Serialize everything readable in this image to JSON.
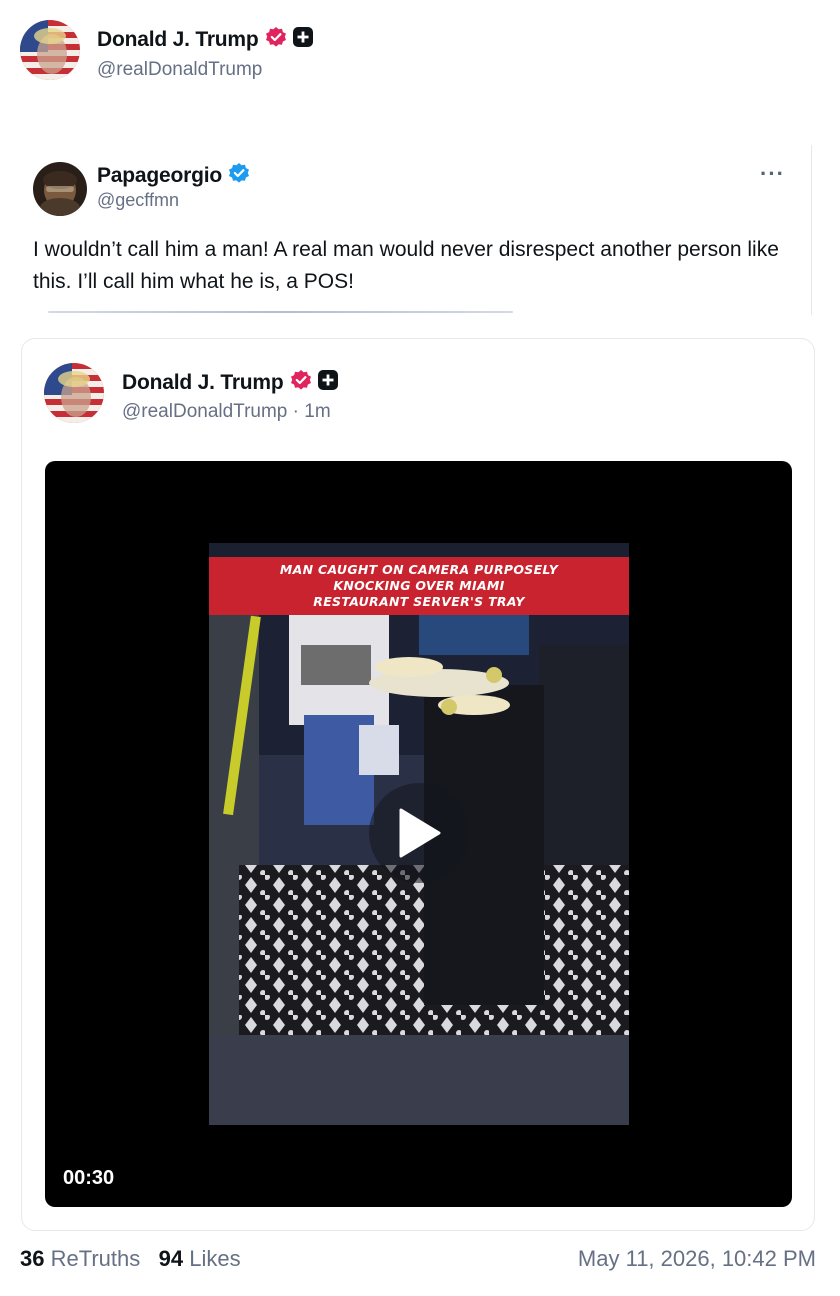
{
  "header": {
    "name": "Donald J. Trump",
    "handle": "@realDonaldTrump",
    "verified_badge_color": "#e0245e"
  },
  "reply": {
    "name": "Papageorgio",
    "handle": "@gecffmn",
    "verified_badge_color": "#1d9bf0",
    "more_label": "···",
    "text": "I wouldn’t call him a man! A real man would never disrespect another person like this. I’ll call him what he is, a POS!"
  },
  "quote": {
    "name": "Donald J. Trump",
    "handle": "@realDonaldTrump",
    "separator": "·",
    "age": "1m"
  },
  "video": {
    "caption_lines": [
      "MAN CAUGHT ON CAMERA PURPOSELY",
      "KNOCKING OVER MIAMI",
      "RESTAURANT SERVER'S TRAY"
    ],
    "duration": "00:30",
    "play_icon": "play-icon"
  },
  "footer": {
    "retruths_count": "36",
    "retruths_label": "ReTruths",
    "likes_count": "94",
    "likes_label": "Likes",
    "timestamp": "May 11, 2026, 10:42 PM"
  }
}
